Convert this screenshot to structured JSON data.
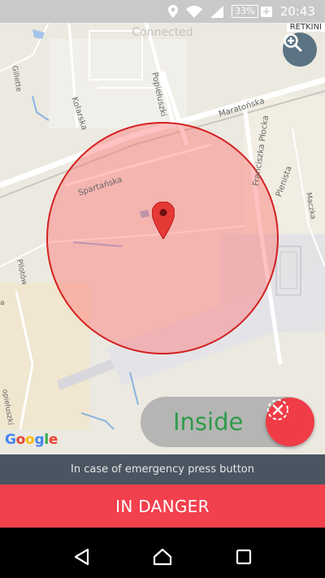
{
  "status_bar": {
    "battery": "33%",
    "time": "20:43",
    "icons": [
      "location-icon",
      "wifi-icon",
      "signal-icon",
      "battery-icon"
    ]
  },
  "map": {
    "connected_text": "Connected",
    "corner_label": "RETKINI",
    "streets": {
      "kolarska": "Kolarska",
      "popieluszki": "Popiełuszki",
      "maratonska": "Maratońska",
      "spartanska": "Spartańska",
      "franciszka_plocka": "Franciszka Płocka",
      "plenista": "Plenista",
      "maczka": "Maczka",
      "gillette": "Gillette",
      "pilotow": "Pilotów",
      "plata": "plata",
      "a": "a",
      "popieluszki_left": "opiełuszki"
    },
    "google": [
      "G",
      "o",
      "o",
      "g",
      "l",
      "e"
    ],
    "google_colors": [
      "#4285F4",
      "#EA4335",
      "#FBBC05",
      "#4285F4",
      "#34A853",
      "#EA4335"
    ],
    "zoom_icon": "zoom-in-icon",
    "marker_icon": "map-pin-icon",
    "zone_color": "#ff6e6e"
  },
  "status_pill": {
    "label": "Inside",
    "icon": "alarm-off-icon"
  },
  "panel": {
    "hint": "In case of emergency press button"
  },
  "danger_button": {
    "label": "IN DANGER"
  },
  "navigation": {
    "back": "back-icon",
    "home": "home-icon",
    "recents": "recents-icon"
  }
}
